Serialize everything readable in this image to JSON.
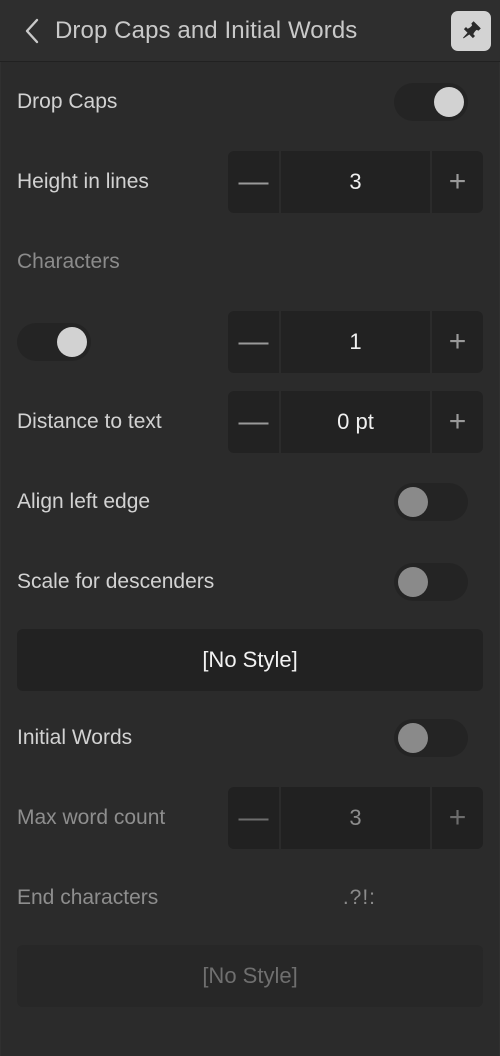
{
  "header": {
    "back_icon": "chevron-left-icon",
    "title": "Drop Caps and Initial Words",
    "pin_icon": "pushpin-icon"
  },
  "rows": {
    "drop_caps": {
      "label": "Drop Caps",
      "toggle_state": "on"
    },
    "height_in_lines": {
      "label": "Height in lines",
      "minus": "—",
      "value": "3",
      "plus": "+"
    },
    "characters_section": {
      "label": "Characters"
    },
    "characters_toggle": {
      "toggle_state": "on",
      "minus": "—",
      "value": "1",
      "plus": "+"
    },
    "distance_to_text": {
      "label": "Distance to text",
      "minus": "—",
      "value": "0 pt",
      "plus": "+"
    },
    "align_left_edge": {
      "label": "Align left edge",
      "toggle_state": "off"
    },
    "scale_for_descenders": {
      "label": "Scale for descenders",
      "toggle_state": "off"
    },
    "drop_caps_style": {
      "label": "[No Style]"
    },
    "initial_words": {
      "label": "Initial Words",
      "toggle_state": "off"
    },
    "max_word_count": {
      "label": "Max word count",
      "minus": "—",
      "value": "3",
      "plus": "+"
    },
    "end_characters": {
      "label": "End characters",
      "value": ".?!:"
    },
    "initial_words_style": {
      "label": "[No Style]"
    }
  },
  "colors": {
    "background": "#2b2b2b",
    "header_background": "#2e2e2e",
    "control_background": "#222222",
    "text_primary": "#d2d2d2",
    "text_dimmed": "#8b8b8b",
    "toggle_on_knob": "#d2d2d2",
    "toggle_off_knob": "#8a8a8a",
    "pin_button_background": "#d3d3d3"
  }
}
